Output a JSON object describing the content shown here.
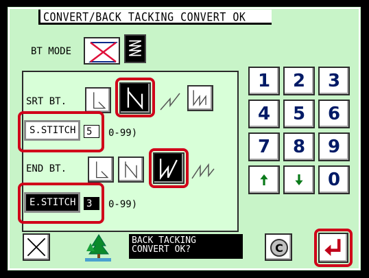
{
  "title": "CONVERT/BACK TACKING CONVERT OK",
  "bt_mode": {
    "label": "BT MODE"
  },
  "start": {
    "label": "SRT BT.",
    "stitch_button": "S.STITCH",
    "stitch_value": "5",
    "range": "0-99)"
  },
  "end": {
    "label": "END BT.",
    "stitch_button": "E.STITCH",
    "stitch_value": "3",
    "range": "0-99)"
  },
  "keypad": {
    "keys": [
      "1",
      "2",
      "3",
      "4",
      "5",
      "6",
      "7",
      "8",
      "9"
    ],
    "up_icon": "up-arrow-icon",
    "down_icon": "down-arrow-icon",
    "zero": "0"
  },
  "message": {
    "line1": "BACK TACKING",
    "line2": "CONVERT OK?"
  },
  "clear_key": "C",
  "colors": {
    "background": "#c8f4c8",
    "panel": "#d8ffd8",
    "highlight": "#d0001a",
    "digit": "#001a66",
    "arrow": "#0a7a1a",
    "enter": "#c0001a"
  }
}
